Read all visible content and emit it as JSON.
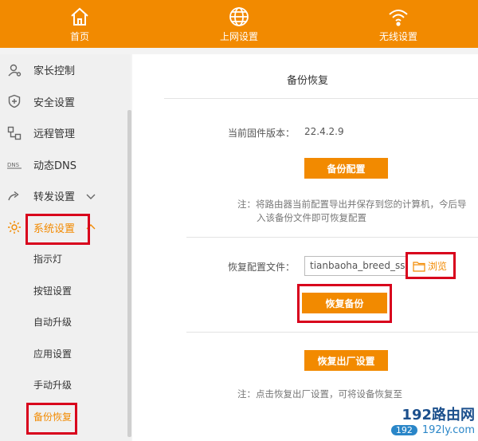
{
  "topnav": {
    "items": [
      {
        "label": "首页",
        "icon": "home-icon"
      },
      {
        "label": "上网设置",
        "icon": "globe-icon"
      },
      {
        "label": "无线设置",
        "icon": "wifi-icon"
      }
    ]
  },
  "sidebar": {
    "items": [
      {
        "label": "家长控制",
        "icon": "parental-control-icon"
      },
      {
        "label": "安全设置",
        "icon": "shield-icon"
      },
      {
        "label": "远程管理",
        "icon": "remote-management-icon"
      },
      {
        "label": "动态DNS",
        "icon": "dns-icon"
      },
      {
        "label": "转发设置",
        "icon": "forward-icon"
      },
      {
        "label": "系统设置",
        "icon": "gear-icon"
      }
    ],
    "dns_icon_text": "DNS",
    "subitems": [
      "指示灯",
      "按钮设置",
      "自动升级",
      "应用设置",
      "手动升级",
      "备份恢复"
    ]
  },
  "main": {
    "title": "备份恢复",
    "firmware_label": "当前固件版本：",
    "firmware_version": "22.4.2.9",
    "backup_button": "备份配置",
    "backup_note_line1": "注：将路由器当前配置导出并保存到您的计算机，今后导",
    "backup_note_line2": "入该备份文件即可恢复配置",
    "restore_file_label": "恢复配置文件：",
    "restore_file_value": "tianbaoha_breed_ssh",
    "browse_label": "浏览",
    "restore_button": "恢复备份",
    "factory_button": "恢复出厂设置",
    "factory_note": "注：点击恢复出厂设置，可将设备恢复至"
  },
  "watermark": {
    "top": "192路由网",
    "bottom": "192ly.com",
    "badge": "192"
  },
  "colors": {
    "accent": "#f28a00",
    "highlight": "#d8001c"
  }
}
